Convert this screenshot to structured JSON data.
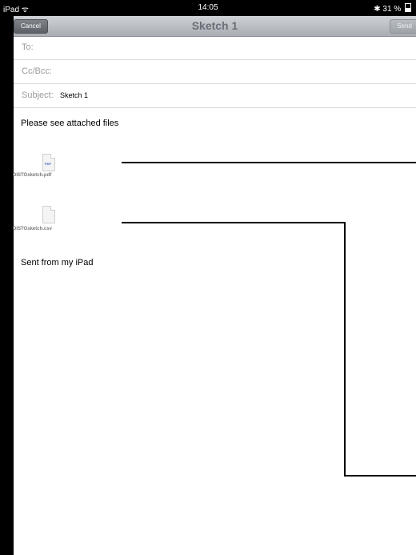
{
  "status_bar": {
    "device": "iPad",
    "wifi_icon": "wifi-icon",
    "time": "14:05",
    "bluetooth_icon": "bluetooth-icon",
    "battery": "31 %"
  },
  "navbar": {
    "cancel_label": "Cancel",
    "title": "Sketch 1",
    "send_label": "Send"
  },
  "fields": {
    "to_label": "To:",
    "ccbcc_label": "Cc/Bcc:",
    "subject_label": "Subject:",
    "subject_value": "Sketch 1"
  },
  "body": {
    "line1": "Please see attached files",
    "attachments": [
      {
        "name": "DISTOsketch.pdf",
        "tag": "PDF",
        "icon": "pdf-file-icon"
      },
      {
        "name": "DISTOsketch.csv",
        "icon": "csv-file-icon"
      }
    ],
    "signature": "Sent from my iPad"
  }
}
